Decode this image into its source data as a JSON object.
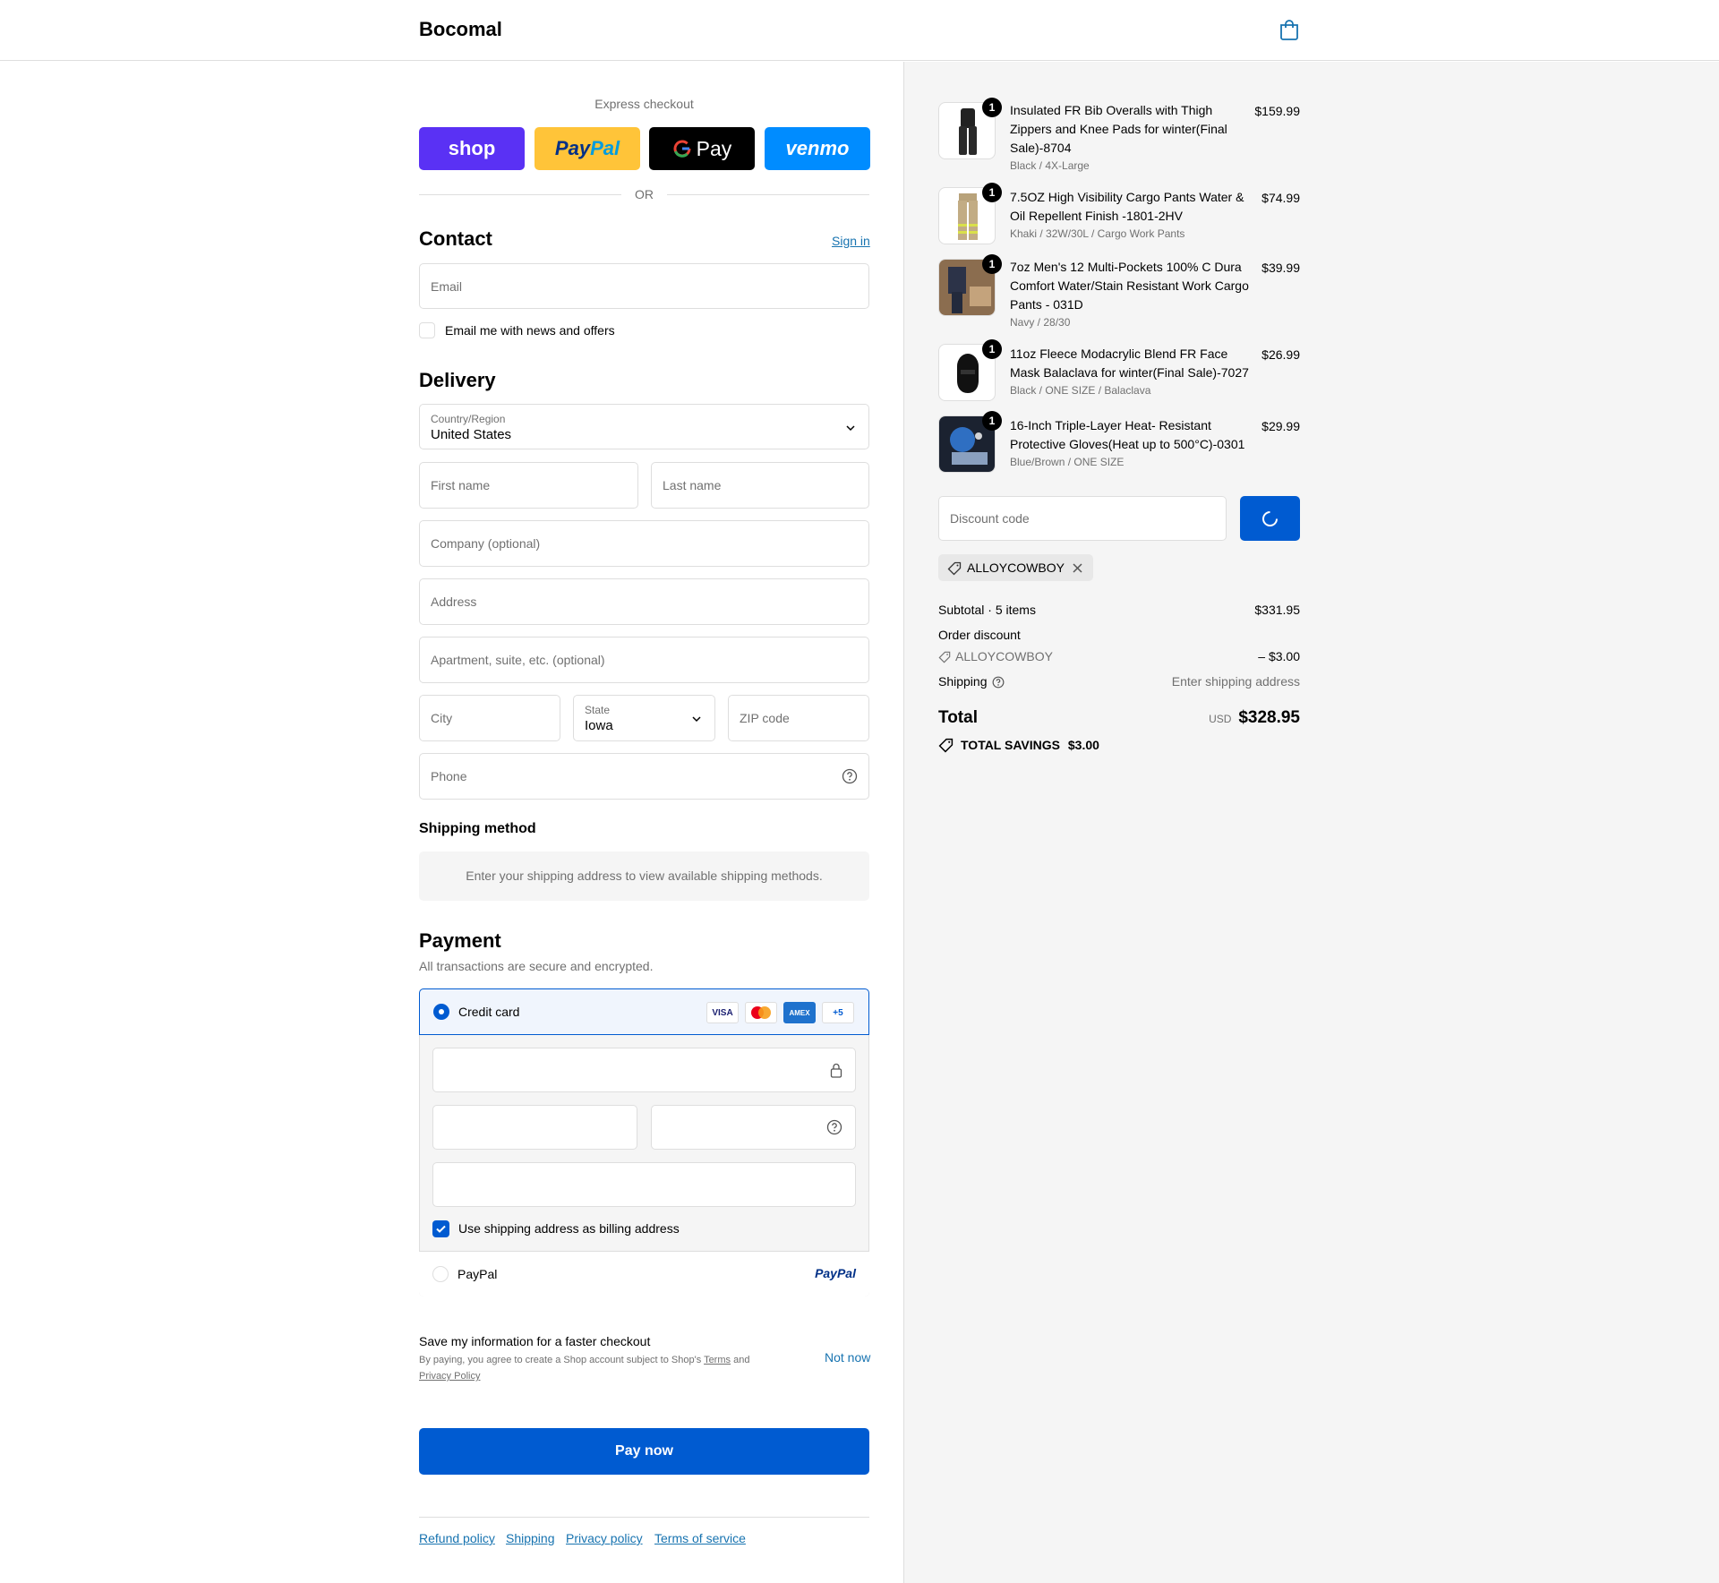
{
  "header": {
    "brand": "Bocomal"
  },
  "express": {
    "title": "Express checkout",
    "buttons": {
      "shop": "shop",
      "paypal": "PayPal",
      "gpay": "Pay",
      "venmo": "venmo"
    },
    "or": "OR"
  },
  "contact": {
    "title": "Contact",
    "sign_in": "Sign in",
    "email_placeholder": "Email",
    "news_label": "Email me with news and offers"
  },
  "delivery": {
    "title": "Delivery",
    "country_label": "Country/Region",
    "country_value": "United States",
    "first_name": "First name",
    "last_name": "Last name",
    "company": "Company (optional)",
    "address": "Address",
    "apartment": "Apartment, suite, etc. (optional)",
    "city": "City",
    "state_label": "State",
    "state_value": "Iowa",
    "zip": "ZIP code",
    "phone": "Phone"
  },
  "shipping_method": {
    "title": "Shipping method",
    "message": "Enter your shipping address to view available shipping methods."
  },
  "payment": {
    "title": "Payment",
    "subtitle": "All transactions are secure and encrypted.",
    "credit_card": "Credit card",
    "cards": [
      "VISA",
      "MC",
      "AMEX",
      "+5"
    ],
    "billing_same": "Use shipping address as billing address",
    "paypal": "PayPal",
    "paypal_logo": "PayPal"
  },
  "save_info": {
    "title": "Save my information for a faster checkout",
    "note_prefix": "By paying, you agree to create a Shop account subject to Shop's",
    "terms": "Terms",
    "and": "and",
    "privacy": "Privacy Policy",
    "not_now": "Not now"
  },
  "pay_now": "Pay now",
  "footer": {
    "links": [
      "Refund policy",
      "Shipping",
      "Privacy policy",
      "Terms of service"
    ]
  },
  "order": {
    "items": [
      {
        "qty": "1",
        "name": "Insulated FR Bib Overalls with Thigh Zippers and Knee Pads for winter(Final Sale)-8704",
        "variant": "Black / 4X-Large",
        "price": "$159.99"
      },
      {
        "qty": "1",
        "name": "7.5OZ High Visibility Cargo Pants Water & Oil Repellent Finish -1801-2HV",
        "variant": "Khaki / 32W/30L / Cargo Work Pants",
        "price": "$74.99"
      },
      {
        "qty": "1",
        "name": "7oz Men's 12 Multi-Pockets 100% C Dura Comfort Water/Stain Resistant Work Cargo Pants - 031D",
        "variant": "Navy / 28/30",
        "price": "$39.99"
      },
      {
        "qty": "1",
        "name": "11oz Fleece Modacrylic Blend FR Face Mask Balaclava for winter(Final Sale)-7027",
        "variant": "Black / ONE SIZE / Balaclava",
        "price": "$26.99"
      },
      {
        "qty": "1",
        "name": "16-Inch Triple-Layer Heat- Resistant Protective Gloves(Heat up to 500°C)-0301",
        "variant": "Blue/Brown / ONE SIZE",
        "price": "$29.99"
      }
    ],
    "discount_placeholder": "Discount code",
    "applied_code": "ALLOYCOWBOY",
    "subtotal_label": "Subtotal · 5 items",
    "subtotal_value": "$331.95",
    "order_discount_label": "Order discount",
    "discount_code": "ALLOYCOWBOY",
    "discount_value": "– $3.00",
    "shipping_label": "Shipping",
    "shipping_value": "Enter shipping address",
    "total_label": "Total",
    "currency": "USD",
    "total_value": "$328.95",
    "savings_label": "TOTAL SAVINGS",
    "savings_value": "$3.00"
  },
  "colors": {
    "accent": "#005bd1",
    "link": "#1773b0",
    "shop": "#5a31f4",
    "paypal": "#ffc439",
    "venmo": "#008cff"
  }
}
